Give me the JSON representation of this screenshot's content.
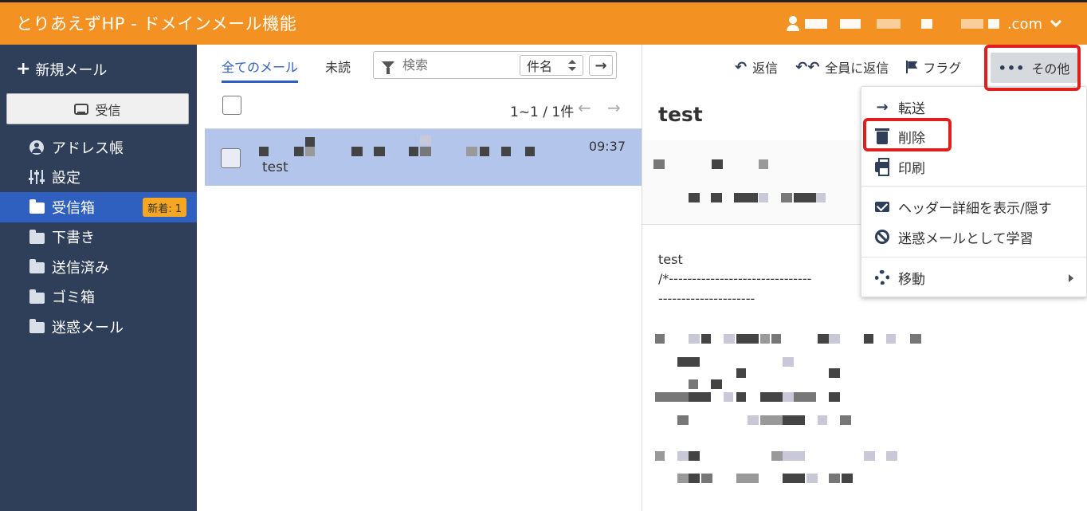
{
  "app": {
    "title": "とりあえずHP - ドメインメール機能",
    "account_suffix": ".com"
  },
  "sidebar": {
    "compose_label": "新規メール",
    "inbox_button_label": "受信",
    "items": [
      {
        "label": "アドレス帳",
        "icon": "address-book-icon"
      },
      {
        "label": "設定",
        "icon": "settings-sliders-icon"
      },
      {
        "label": "受信箱",
        "icon": "folder-icon",
        "active": true,
        "badge": "新着: 1"
      },
      {
        "label": "下書き",
        "icon": "folder-icon"
      },
      {
        "label": "送信済み",
        "icon": "folder-icon"
      },
      {
        "label": "ゴミ箱",
        "icon": "folder-icon"
      },
      {
        "label": "迷惑メール",
        "icon": "folder-icon"
      }
    ]
  },
  "list": {
    "tabs": [
      {
        "label": "全てのメール",
        "active": true
      },
      {
        "label": "未読"
      }
    ],
    "search": {
      "placeholder": "検索",
      "field": "件名"
    },
    "pager": "1~1 / 1件",
    "messages": [
      {
        "time": "09:37",
        "subject": "test",
        "selected": true
      }
    ]
  },
  "reader": {
    "toolbar": {
      "reply": "返信",
      "reply_all": "全員に返信",
      "flag": "フラグ",
      "more": "その他"
    },
    "title": "test",
    "body_lines": [
      "test",
      "/*-------------------------------",
      "---------------------"
    ]
  },
  "more_menu": {
    "items": [
      {
        "label": "転送",
        "icon": "arrow-right-icon"
      },
      {
        "label": "削除",
        "icon": "trash-icon"
      },
      {
        "label": "印刷",
        "icon": "print-icon"
      },
      {
        "label": "ヘッダー詳細を表示/隠す",
        "icon": "envelope-icon"
      },
      {
        "label": "迷惑メールとして学習",
        "icon": "ban-icon"
      },
      {
        "label": "移動",
        "icon": "gear-icon"
      }
    ]
  },
  "colors": {
    "header": "#f39222",
    "sidebar": "#2f3e59",
    "active": "#2f5fbf",
    "highlight": "#e21d1d",
    "selected_row": "#b3c5ea"
  }
}
